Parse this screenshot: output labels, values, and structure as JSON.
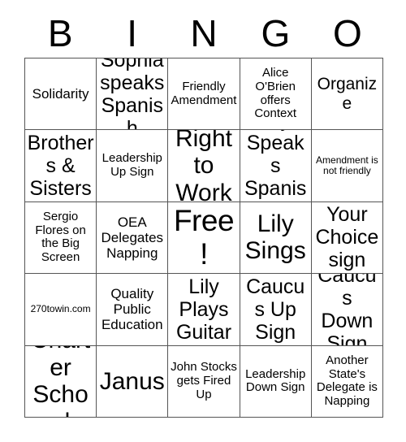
{
  "header": {
    "letters": [
      "B",
      "I",
      "N",
      "G",
      "O"
    ]
  },
  "grid": {
    "rows": 5,
    "columns": 5,
    "border_color": "#555555",
    "background": "#ffffff",
    "text_color": "#000000",
    "cells": [
      {
        "text": "Solidarity",
        "size": "md"
      },
      {
        "text": "Sophia speaks Spanish",
        "size": "xl"
      },
      {
        "text": "Friendly Amendment",
        "size": "sm"
      },
      {
        "text": "Alice O'Brien offers Context",
        "size": "sm"
      },
      {
        "text": "Organize",
        "size": "lg"
      },
      {
        "text": "Brothers & Sisters",
        "size": "xl"
      },
      {
        "text": "Leadership Up Sign",
        "size": "sm"
      },
      {
        "text": "Right to Work",
        "size": "xxl"
      },
      {
        "text": "Lily Speaks Spanish",
        "size": "xl"
      },
      {
        "text": "Amendment is not friendly",
        "size": "xs"
      },
      {
        "text": "Sergio Flores on the Big Screen",
        "size": "sm"
      },
      {
        "text": "OEA Delegates Napping",
        "size": "md"
      },
      {
        "text": "Free!",
        "size": "free"
      },
      {
        "text": "Lily Sings",
        "size": "xxl"
      },
      {
        "text": "Your Choice sign",
        "size": "xl"
      },
      {
        "text": "270towin.com",
        "size": "xs"
      },
      {
        "text": "Quality Public Education",
        "size": "md"
      },
      {
        "text": "Lily Plays Guitar",
        "size": "xl"
      },
      {
        "text": "Caucus Up Sign",
        "size": "xl"
      },
      {
        "text": "Caucus Down Sign",
        "size": "xl"
      },
      {
        "text": "Charter School",
        "size": "xxl"
      },
      {
        "text": "Janus",
        "size": "xxl"
      },
      {
        "text": "John Stocks gets Fired Up",
        "size": "sm"
      },
      {
        "text": "Leadership Down Sign",
        "size": "sm"
      },
      {
        "text": "Another State's Delegate is Napping",
        "size": "sm"
      }
    ]
  }
}
